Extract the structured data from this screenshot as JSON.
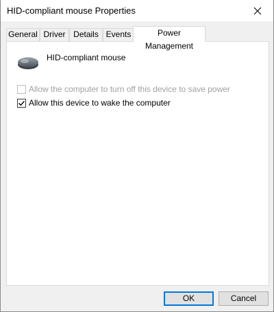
{
  "window": {
    "title": "HID-compliant mouse Properties"
  },
  "tabs": [
    {
      "label": "General"
    },
    {
      "label": "Driver"
    },
    {
      "label": "Details"
    },
    {
      "label": "Events"
    },
    {
      "label": "Power Management",
      "active": true
    }
  ],
  "device": {
    "name": "HID-compliant mouse",
    "icon": "mouse-icon"
  },
  "options": {
    "turn_off": {
      "label": "Allow the computer to turn off this device to save power",
      "checked": false,
      "enabled": false
    },
    "wake": {
      "label": "Allow this device to wake the computer",
      "checked": true,
      "enabled": true
    }
  },
  "buttons": {
    "ok": "OK",
    "cancel": "Cancel"
  },
  "colors": {
    "accent": "#0078d7",
    "disabled_text": "#a0a0a0"
  }
}
